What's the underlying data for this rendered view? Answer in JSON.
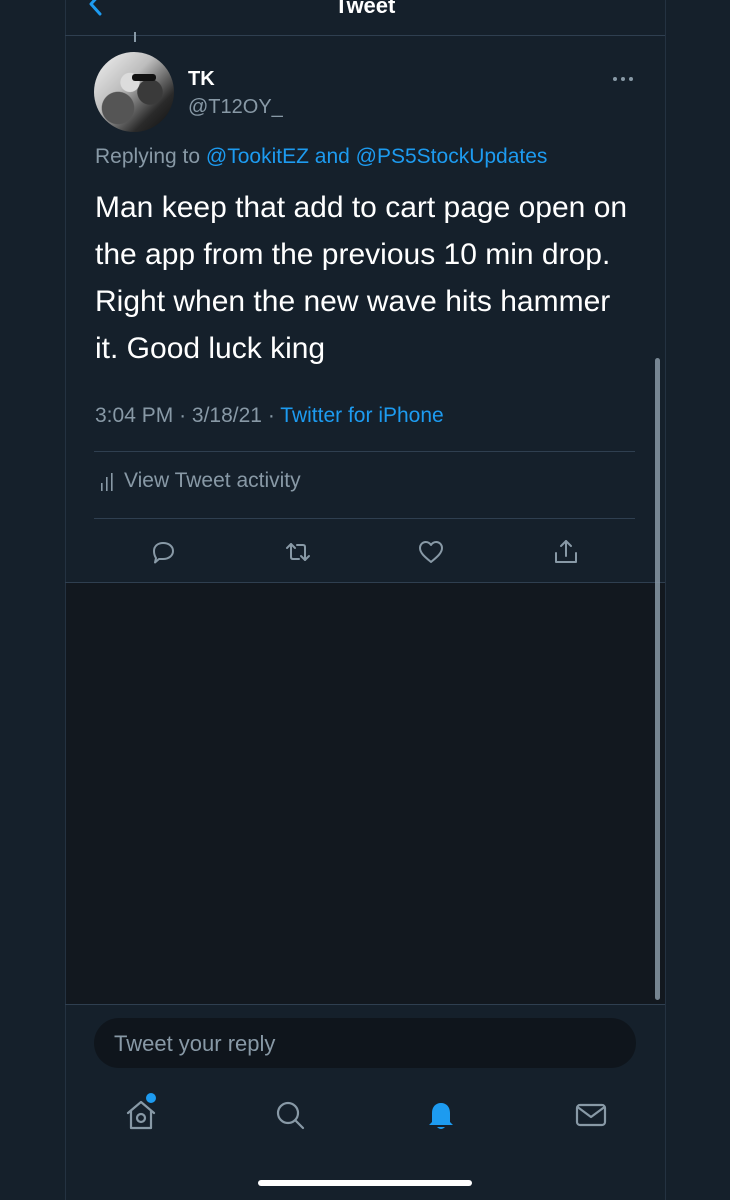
{
  "header": {
    "title": "Tweet",
    "back_icon": "chevron-left-icon"
  },
  "tweet": {
    "author_name": "TK",
    "author_handle": "@T12OY_",
    "replying_prefix": "Replying to",
    "replying_user_1": "@TookitEZ",
    "replying_and": "and",
    "replying_user_2": "@PS5StockUpdates",
    "text": "Man keep that add to cart page open on the app from the previous 10 min drop. Right when the new wave hits hammer it. Good luck king",
    "time": "3:04 PM",
    "date": "3/18/21",
    "source": "Twitter for iPhone",
    "activity_label": "View Tweet activity"
  },
  "actions": [
    "reply-icon",
    "retweet-icon",
    "like-icon",
    "share-icon"
  ],
  "reply": {
    "placeholder": "Tweet your reply"
  },
  "tabs": [
    "home-icon",
    "search-icon",
    "notifications-icon",
    "messages-icon"
  ],
  "colors": {
    "background": "#15202b",
    "accent": "#1d9bf0",
    "muted": "#8899a6"
  }
}
